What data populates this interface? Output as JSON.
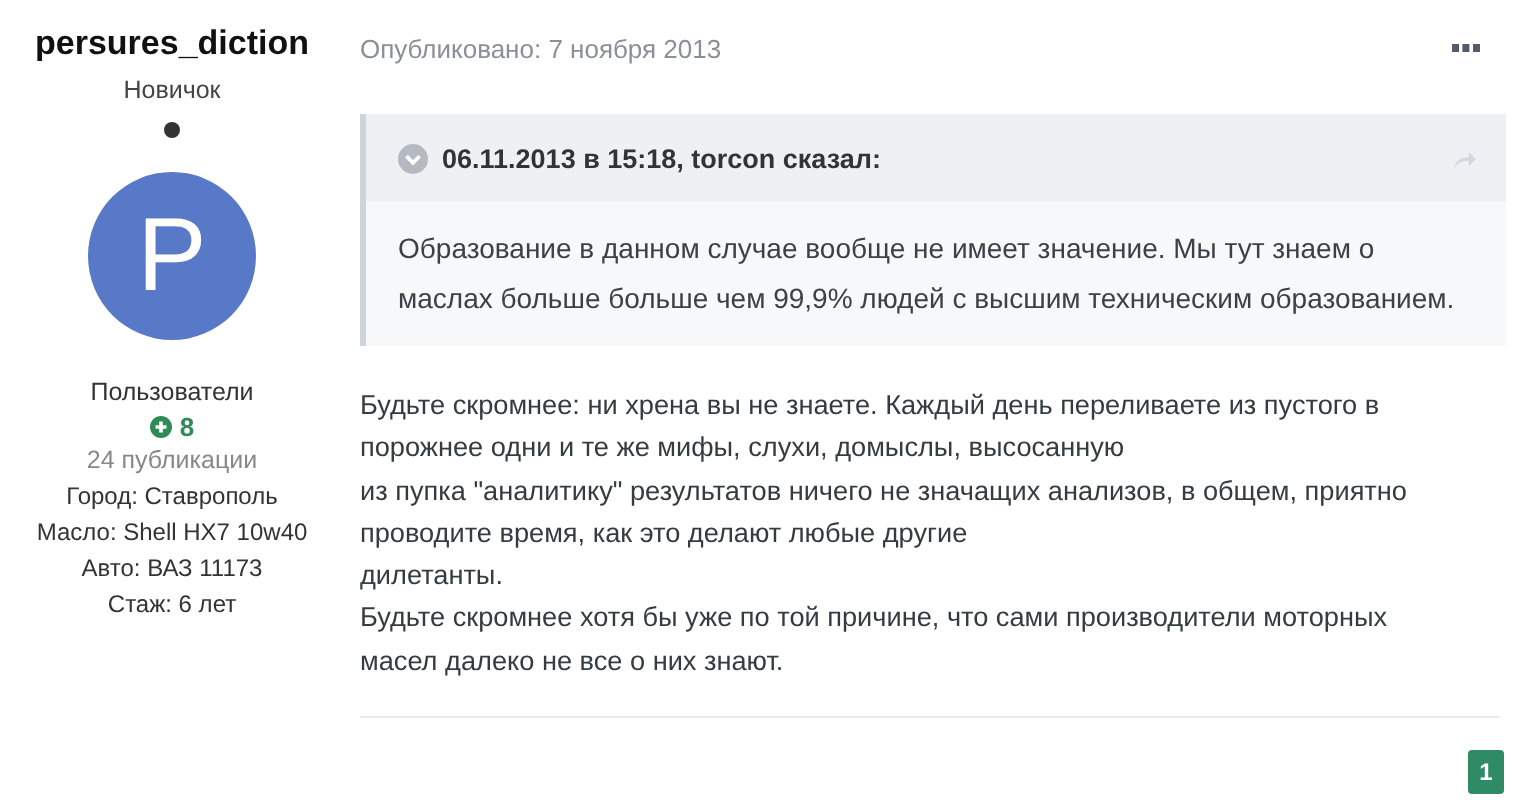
{
  "author": {
    "name": "persures_diction",
    "rank": "Новичок",
    "online": true,
    "avatar_letter": "P",
    "group": "Пользователи",
    "reputation": "8",
    "posts": "24 публикации",
    "fields": [
      {
        "label": "Город:",
        "value": "Ставрополь"
      },
      {
        "label": "Масло:",
        "value": "Shell HX7 10w40"
      },
      {
        "label": "Авто:",
        "value": "ВАЗ 11173"
      },
      {
        "label": "Стаж:",
        "value": "6 лет"
      }
    ]
  },
  "post": {
    "published": "Опубликовано: 7 ноября 2013",
    "quote": {
      "header": "06.11.2013 в 15:18, torcon сказал:",
      "text": "Образование в данном случае вообще не имеет значение. Мы тут знаем о маслах больше больше чем 99,9% людей с высшим техническим образованием."
    },
    "lines": [
      "Будьте скромнее: ни хрена вы не знаете. Каждый день переливаете из пустого в",
      "порожнее одни и те же мифы, слухи, домыслы, высосанную",
      "из пупка \"аналитику\" результатов ничего не значащих анализов, в общем, приятно",
      "проводите время, как это делают любые другие",
      "дилетанты.",
      "Будьте скромнее хотя бы уже по той причине, что сами производители моторных",
      "масел далеко не все о них знают."
    ]
  },
  "pagination": [
    {
      "label": "1",
      "selected": true
    }
  ]
}
